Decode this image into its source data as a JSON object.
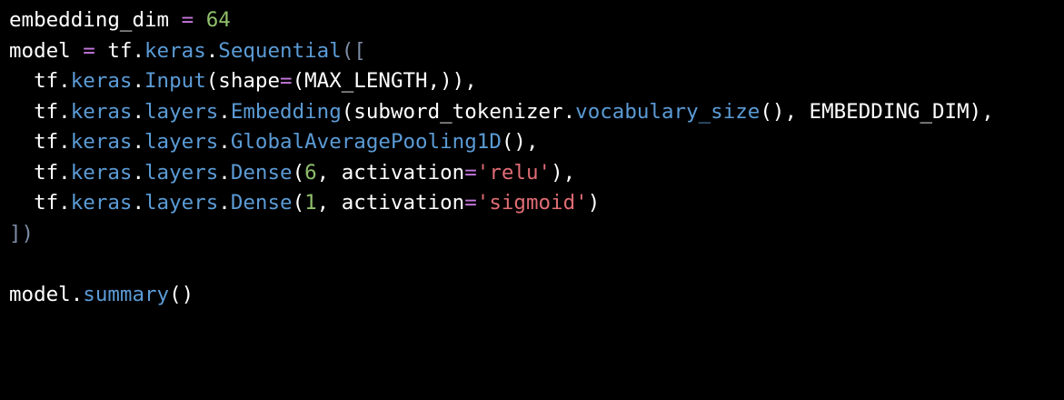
{
  "colors": {
    "background": "#000000",
    "default": "#ffffff",
    "operator": "#c678dd",
    "attribute": "#5b9bd5",
    "number": "#8fbf6a",
    "string": "#e06c75",
    "bracket": "#7d8da6"
  },
  "code": {
    "lines": [
      [
        {
          "t": "embedding_dim ",
          "k": "default"
        },
        {
          "t": "=",
          "k": "operator"
        },
        {
          "t": " ",
          "k": "default"
        },
        {
          "t": "64",
          "k": "number"
        }
      ],
      [
        {
          "t": "model ",
          "k": "default"
        },
        {
          "t": "=",
          "k": "operator"
        },
        {
          "t": " tf.",
          "k": "default"
        },
        {
          "t": "keras",
          "k": "attribute"
        },
        {
          "t": ".",
          "k": "default"
        },
        {
          "t": "Sequential",
          "k": "attribute"
        },
        {
          "t": "([",
          "k": "bracket"
        }
      ],
      [
        {
          "t": "  tf.",
          "k": "default"
        },
        {
          "t": "keras",
          "k": "attribute"
        },
        {
          "t": ".",
          "k": "default"
        },
        {
          "t": "Input",
          "k": "attribute"
        },
        {
          "t": "(shape",
          "k": "default"
        },
        {
          "t": "=",
          "k": "operator"
        },
        {
          "t": "(MAX_LENGTH,)),",
          "k": "default"
        }
      ],
      [
        {
          "t": "  tf.",
          "k": "default"
        },
        {
          "t": "keras",
          "k": "attribute"
        },
        {
          "t": ".",
          "k": "default"
        },
        {
          "t": "layers",
          "k": "attribute"
        },
        {
          "t": ".",
          "k": "default"
        },
        {
          "t": "Embedding",
          "k": "attribute"
        },
        {
          "t": "(subword_tokenizer.",
          "k": "default"
        },
        {
          "t": "vocabulary_size",
          "k": "attribute"
        },
        {
          "t": "(), EMBEDDING_DIM),",
          "k": "default"
        }
      ],
      [
        {
          "t": "  tf.",
          "k": "default"
        },
        {
          "t": "keras",
          "k": "attribute"
        },
        {
          "t": ".",
          "k": "default"
        },
        {
          "t": "layers",
          "k": "attribute"
        },
        {
          "t": ".",
          "k": "default"
        },
        {
          "t": "GlobalAveragePooling1D",
          "k": "attribute"
        },
        {
          "t": "(),",
          "k": "default"
        }
      ],
      [
        {
          "t": "  tf.",
          "k": "default"
        },
        {
          "t": "keras",
          "k": "attribute"
        },
        {
          "t": ".",
          "k": "default"
        },
        {
          "t": "layers",
          "k": "attribute"
        },
        {
          "t": ".",
          "k": "default"
        },
        {
          "t": "Dense",
          "k": "attribute"
        },
        {
          "t": "(",
          "k": "default"
        },
        {
          "t": "6",
          "k": "number"
        },
        {
          "t": ", activation",
          "k": "default"
        },
        {
          "t": "=",
          "k": "operator"
        },
        {
          "t": "'relu'",
          "k": "string"
        },
        {
          "t": "),",
          "k": "default"
        }
      ],
      [
        {
          "t": "  tf.",
          "k": "default"
        },
        {
          "t": "keras",
          "k": "attribute"
        },
        {
          "t": ".",
          "k": "default"
        },
        {
          "t": "layers",
          "k": "attribute"
        },
        {
          "t": ".",
          "k": "default"
        },
        {
          "t": "Dense",
          "k": "attribute"
        },
        {
          "t": "(",
          "k": "default"
        },
        {
          "t": "1",
          "k": "number"
        },
        {
          "t": ", activation",
          "k": "default"
        },
        {
          "t": "=",
          "k": "operator"
        },
        {
          "t": "'sigmoid'",
          "k": "string"
        },
        {
          "t": ")",
          "k": "default"
        }
      ],
      [
        {
          "t": "])",
          "k": "bracket"
        }
      ],
      [],
      [
        {
          "t": "model.",
          "k": "default"
        },
        {
          "t": "summary",
          "k": "attribute"
        },
        {
          "t": "()",
          "k": "default"
        }
      ]
    ]
  }
}
